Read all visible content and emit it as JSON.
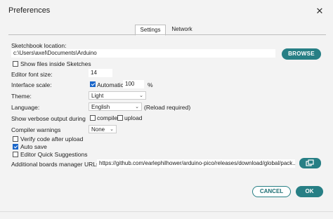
{
  "window": {
    "title": "Preferences",
    "close_glyph": "✕"
  },
  "tabs": [
    {
      "label": "Settings",
      "active": true
    },
    {
      "label": "Network",
      "active": false
    }
  ],
  "settings": {
    "sketchbook_location_label": "Sketchbook location:",
    "sketchbook_location_value": "c:\\Users\\axel\\Documents\\Arduino",
    "browse_label": "BROWSE",
    "show_files_label": "Show files inside Sketches",
    "show_files_checked": false,
    "font_size_label": "Editor font size:",
    "font_size_value": "14",
    "interface_scale_label": "Interface scale:",
    "automatic_label": "Automatic",
    "automatic_checked": true,
    "scale_value": "100",
    "scale_unit": "%",
    "theme_label": "Theme:",
    "theme_value": "Light",
    "language_label": "Language:",
    "language_value": "English",
    "language_note": "(Reload required)",
    "verbose_label": "Show verbose output during",
    "compile_label": "compile",
    "compile_checked": false,
    "upload_label": "upload",
    "upload_checked": false,
    "compiler_warnings_label": "Compiler warnings",
    "compiler_warnings_value": "None",
    "verify_label": "Verify code after upload",
    "verify_checked": false,
    "autosave_label": "Auto save",
    "autosave_checked": true,
    "quick_suggestions_label": "Editor Quick Suggestions",
    "quick_suggestions_checked": false,
    "boards_urls_label": "Additional boards manager URLs:",
    "boards_urls_value": "https://github.com/earlephilhower/arduino-pico/releases/download/global/pack..."
  },
  "footer": {
    "cancel_label": "CANCEL",
    "ok_label": "OK"
  },
  "colors": {
    "accent": "#277f85",
    "checkbox_checked": "#1a66c9"
  },
  "icons": {
    "close": "close-icon",
    "chevron": "chevron-down-icon",
    "open_editor": "open-in-new-window-icon"
  }
}
